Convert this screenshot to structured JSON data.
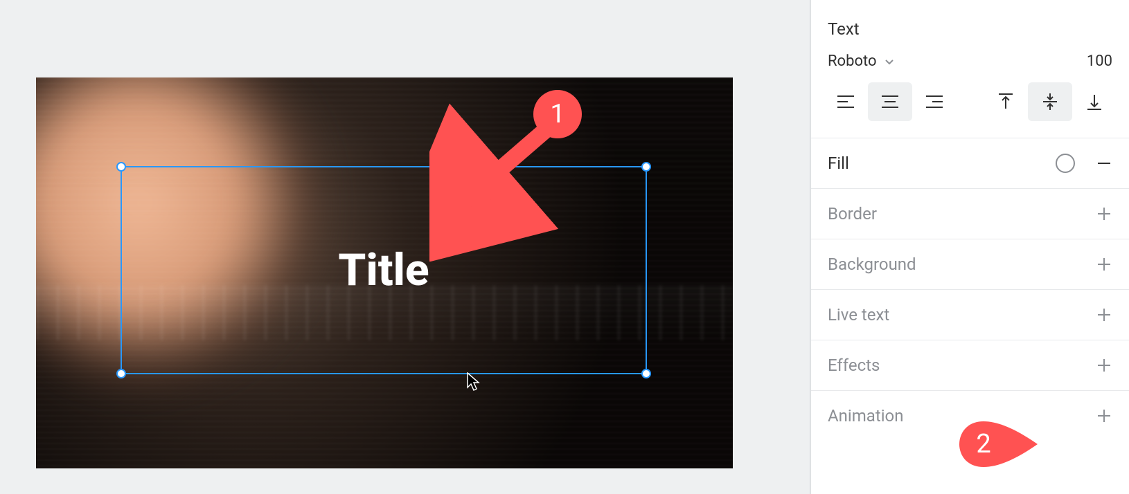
{
  "canvas": {
    "title_text": "Title"
  },
  "annotations": {
    "badge1": "1",
    "badge2": "2"
  },
  "sidebar": {
    "text_panel": {
      "label": "Text",
      "font_name": "Roboto",
      "font_size": "100"
    },
    "fill": {
      "label": "Fill"
    },
    "border": {
      "label": "Border"
    },
    "background": {
      "label": "Background"
    },
    "live_text": {
      "label": "Live text"
    },
    "effects": {
      "label": "Effects"
    },
    "animation": {
      "label": "Animation"
    }
  }
}
